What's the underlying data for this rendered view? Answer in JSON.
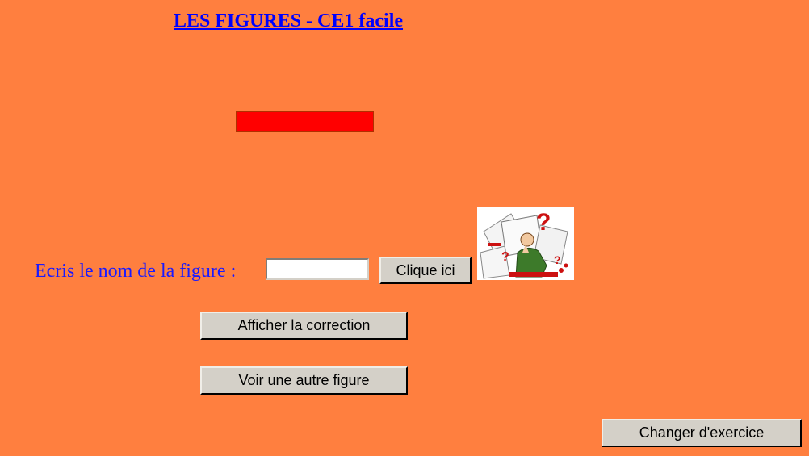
{
  "page": {
    "title": "LES FIGURES - CE1 facile"
  },
  "figure": {
    "color": "#ff0000",
    "shape": "rectangle"
  },
  "form": {
    "prompt": "Ecris le nom de la figure :",
    "answer_value": "",
    "check_button_label": "Clique ici"
  },
  "actions": {
    "correction_label": "Afficher la correction",
    "other_figure_label": "Voir une autre figure",
    "change_exercise_label": "Changer d'exercice"
  },
  "illustration": {
    "icon": "thinking-student-question-marks"
  },
  "colors": {
    "background": "#ff7f3f",
    "title": "#0000ff",
    "prompt": "#1a1aff",
    "button_face": "#d4d0c8"
  }
}
